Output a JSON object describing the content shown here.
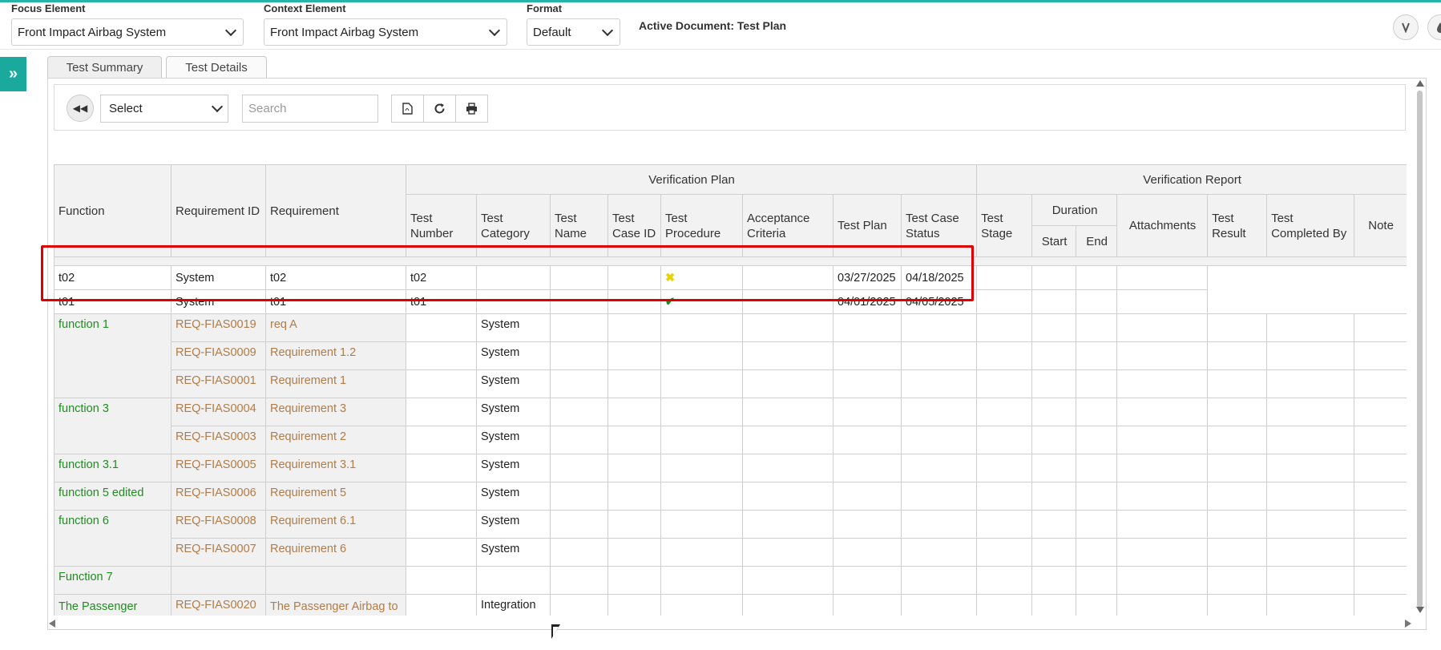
{
  "header": {
    "focus_label": "Focus Element",
    "focus_value": "Front Impact Airbag System",
    "context_label": "Context Element",
    "context_value": "Front Impact Airbag System",
    "format_label": "Format",
    "format_value": "Default",
    "active_document": "Active Document: Test Plan"
  },
  "icons": {
    "sidebar_toggle": "double-chevron-right-icon",
    "first_page": "rewind-icon",
    "pdf": "pdf-icon",
    "refresh": "refresh-icon",
    "print": "print-icon"
  },
  "tabs": [
    {
      "label": "Test Summary"
    },
    {
      "label": "Test Details"
    }
  ],
  "tools": {
    "select_value": "Select",
    "search_placeholder": "Search"
  },
  "groups": {
    "verification_plan": "Verification Plan",
    "verification_report": "Verification Report",
    "duration": "Duration"
  },
  "columns": {
    "function": "Function",
    "requirement_id": "Requirement ID",
    "requirement": "Requirement",
    "test_number": "Test Number",
    "test_category": "Test Category",
    "test_name": "Test Name",
    "test_case_id": "Test Case ID",
    "test_procedure": "Test Procedure",
    "acceptance_criteria": "Acceptance Criteria",
    "test_plan": "Test Plan",
    "test_case_status": "Test Case Status",
    "test_stage": "Test Stage",
    "start": "Start",
    "end": "End",
    "attachments": "Attachments",
    "test_result": "Test Result",
    "test_completed_by": "Test Completed By",
    "note": "Note"
  },
  "test_rows": [
    {
      "function": "t02",
      "requirement_id": "System",
      "requirement": "t02",
      "test_number": "t02",
      "procedure": "✖",
      "test_plan": "03/27/2025",
      "status": "04/18/2025"
    },
    {
      "function": "t01",
      "requirement_id": "System",
      "requirement": "t01",
      "test_number": "t01",
      "procedure": "✔",
      "test_plan": "04/01/2025",
      "status": "04/05/2025"
    }
  ],
  "req_rows": [
    {
      "function": "function 1",
      "id": "REQ-FIAS0019",
      "req": "req A",
      "category": "System"
    },
    {
      "function": "",
      "id": "REQ-FIAS0009",
      "req": "Requirement 1.2",
      "category": "System"
    },
    {
      "function": "",
      "id": "REQ-FIAS0001",
      "req": "Requirement 1",
      "category": "System"
    },
    {
      "function": "function 3",
      "id": "REQ-FIAS0004",
      "req": "Requirement 3",
      "category": "System"
    },
    {
      "function": "",
      "id": "REQ-FIAS0003",
      "req": "Requirement 2",
      "category": "System"
    },
    {
      "function": "function 3.1",
      "id": "REQ-FIAS0005",
      "req": "Requirement 3.1",
      "category": "System"
    },
    {
      "function": "function 5 edited",
      "id": "REQ-FIAS0006",
      "req": "Requirement 5",
      "category": "System"
    },
    {
      "function": "function 6",
      "id": "REQ-FIAS0008",
      "req": "Requirement 6.1",
      "category": "System"
    },
    {
      "function": "",
      "id": "REQ-FIAS0007",
      "req": "Requirement 6",
      "category": "System"
    },
    {
      "function": "Function 7",
      "id": "",
      "req": "",
      "category": ""
    },
    {
      "function": "The Passenger Airbag to the Front Sensor Interface Function (P)",
      "id": "REQ-FIAS0020",
      "req": "The Passenger Airbag to the Front Sensor Interface Requirement (P)",
      "category": "Integration"
    }
  ],
  "colors": {
    "accent": "#1aa99d",
    "function_text": "#228b22",
    "requirement_text": "#b07c48",
    "highlight": "#e00000"
  }
}
